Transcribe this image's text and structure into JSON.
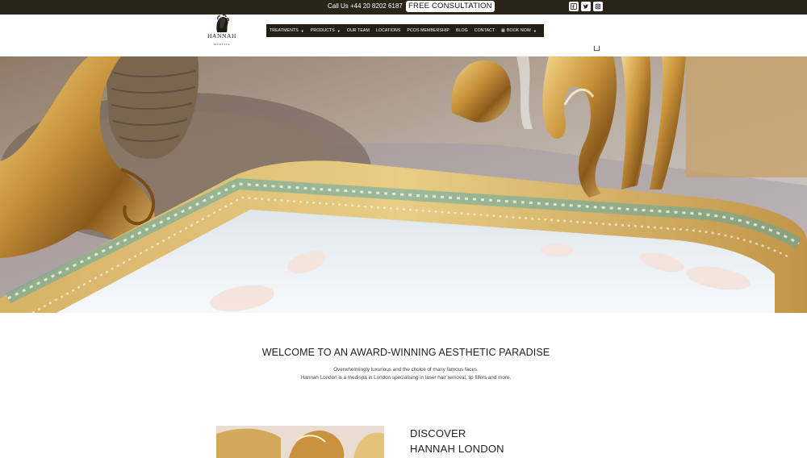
{
  "topbar": {
    "phone": "Call Us +44 20 8202 6187",
    "consultation_label": "FREE CONSULTATION",
    "social_icons": [
      "facebook-icon",
      "twitter-icon",
      "instagram-icon"
    ]
  },
  "header": {
    "logo_text": "HANNAH",
    "logo_subtext": "MEDISPA",
    "nav": [
      {
        "label": "TREATMENTS",
        "has_dropdown": true
      },
      {
        "label": "PRODUCTS",
        "has_dropdown": true
      },
      {
        "label": "OUR TEAM",
        "has_dropdown": false
      },
      {
        "label": "LOCATIONS",
        "has_dropdown": false
      },
      {
        "label": "PCOS MEMBERSHIP",
        "has_dropdown": false
      },
      {
        "label": "BLOG",
        "has_dropdown": false
      },
      {
        "label": "CONTACT",
        "has_dropdown": false
      },
      {
        "label": "BOOK NOW",
        "has_dropdown": true
      }
    ]
  },
  "welcome": {
    "title": "WELCOME TO AN AWARD-WINNING AESTHETIC PARADISE",
    "line1": "Overwhelmingly luxurious and the choice of many famous faces.",
    "line2": "Hannah London is a medispa in London specialising in laser hair removal, lip fillers and more."
  },
  "discover": {
    "line1": "DISCOVER",
    "line2": "HANNAH LONDON"
  },
  "colors": {
    "topbar": "#2b2419",
    "nav": "#231e16",
    "gold": "#c9a04a",
    "teal": "#5fa9a6"
  }
}
